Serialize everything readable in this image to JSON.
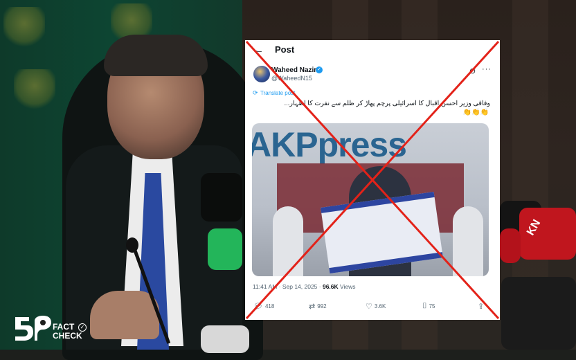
{
  "tweet": {
    "header_title": "Post",
    "author_name": "Waheed Nazir",
    "author_handle": "@WaheedN15",
    "translate_label": "Translate post",
    "text": "وفاقی وزیر احسن اقبال کا اسرائیلی پرچم پھاڑ کر ظلم سے نفرت کا اظہار...",
    "emojis": "👏👏👏",
    "video_banner_text": "AKPpress",
    "timestamp": "11:41 AM · Sep 14, 2025 · ",
    "views_count": "96.6K",
    "views_label": " Views",
    "replies": "418",
    "reposts": "992",
    "likes": "3.6K",
    "bookmarks": "75"
  },
  "overlay": {
    "cross_color": "#e32219"
  },
  "background": {
    "mic_label_1": "KN",
    "mic_label_2": "KN"
  },
  "logo": {
    "line1": "FACT",
    "line2": "CHECK"
  },
  "icons": [
    "back-arrow-icon",
    "verified-icon",
    "grok-icon",
    "more-icon",
    "translate-icon",
    "reply-icon",
    "repost-icon",
    "like-icon",
    "bookmark-icon",
    "share-icon"
  ]
}
